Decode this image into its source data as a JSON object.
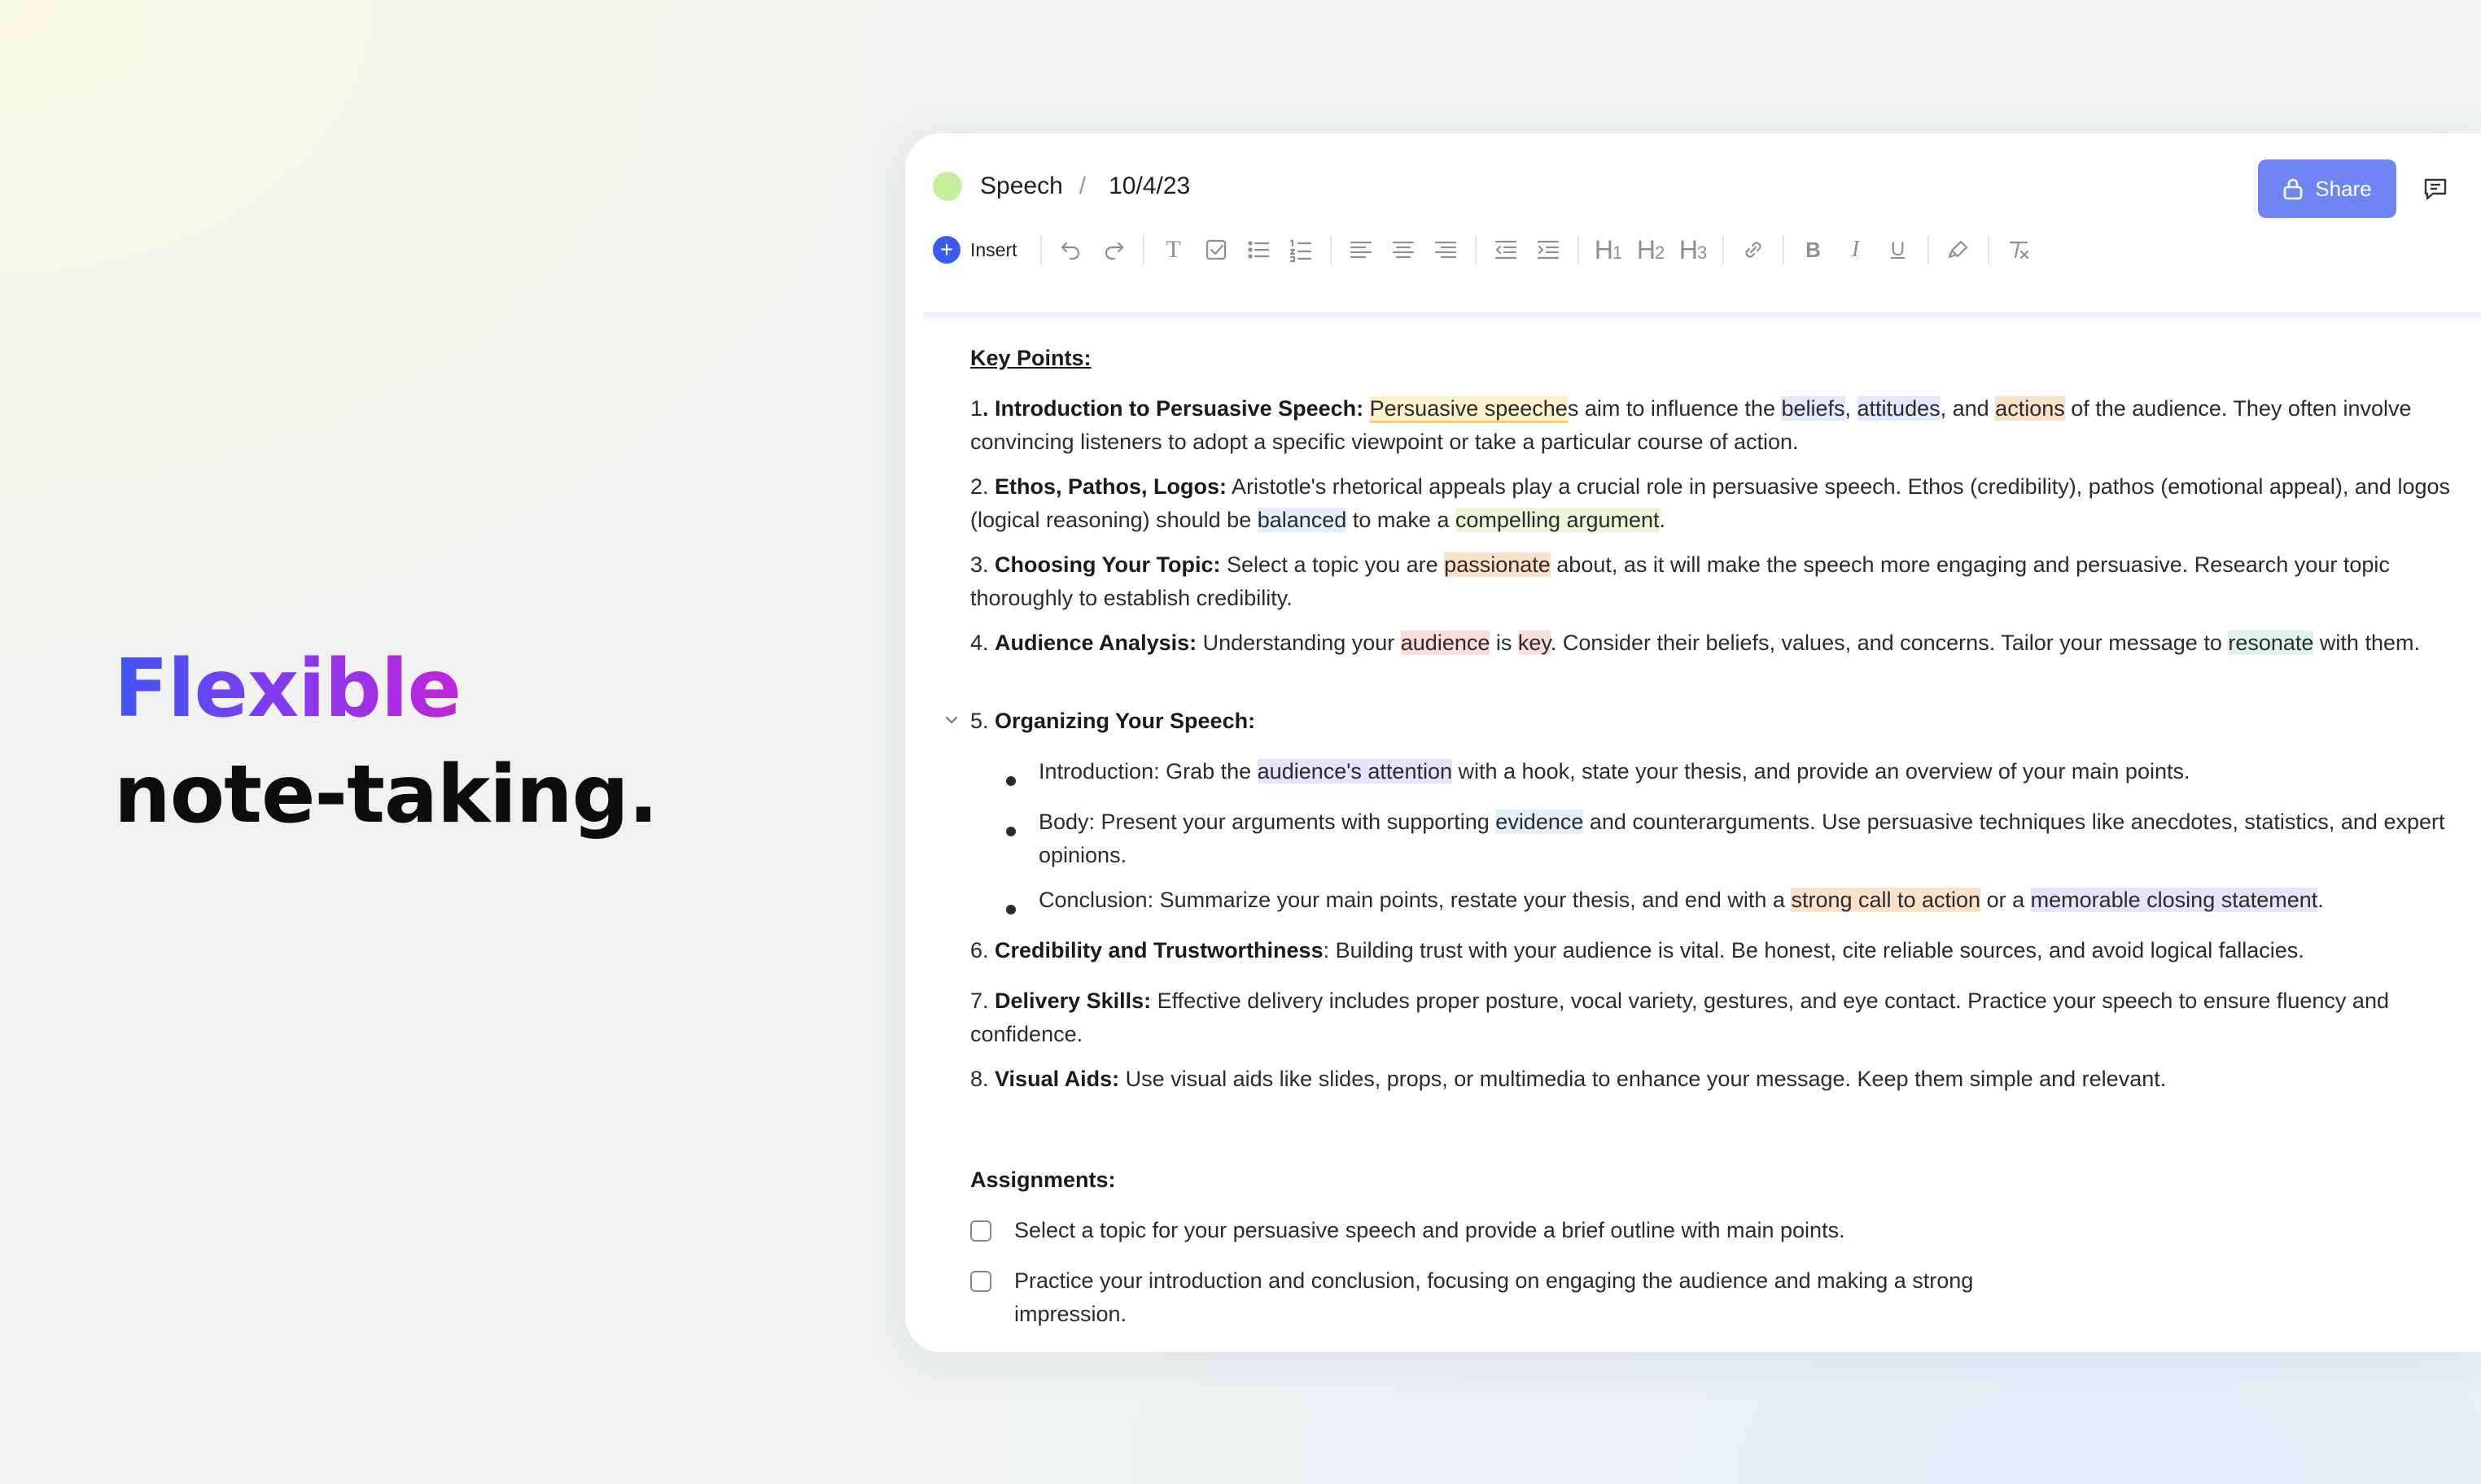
{
  "hero": {
    "line1": "Flexible",
    "line2": "note-taking."
  },
  "titlebar": {
    "title": "Speech",
    "separator": "/",
    "date": "10/4/23"
  },
  "share": {
    "label": "Share"
  },
  "toolbar": {
    "insert_label": "Insert"
  },
  "doc": {
    "key_points_heading": "Key Points:",
    "p1": {
      "num": "1",
      "bold": ". Introduction to Persuasive Speech:",
      "hl1": "Persuasive speeche",
      "t1": "s aim to influence the ",
      "hl2": "beliefs",
      "t2": ", ",
      "hl3": "attitudes",
      "t3": ", and ",
      "hl4": "actions",
      "t4": " of the audience. They often involve convincing listeners to adopt a specific viewpoint or take a particular course of action."
    },
    "p2": {
      "num": "2. ",
      "bold": "Ethos, Pathos, Logos:",
      "t1": " Aristotle's rhetorical appeals play a crucial role in persuasive speech. Ethos (credibility), pathos (emotional appeal), and logos (logical reasoning) should be ",
      "hl1": "balanced",
      "t2": " to make a ",
      "hl2": "compelling argument",
      "t3": "."
    },
    "p3": {
      "num": "3. ",
      "bold": "Choosing Your Topic:",
      "t1": " Select a topic you are ",
      "hl1": "passionate",
      "t2": " about, as it will make the speech more engaging and persuasive. Research your topic thoroughly to establish credibility."
    },
    "p4": {
      "num": "4. ",
      "bold": "Audience Analysis:",
      "t1": " Understanding your ",
      "hl1": "audience",
      "t2": " is ",
      "hl2": "key",
      "t3": ". Consider their beliefs, values, and concerns. Tailor your message to ",
      "hl3": "resonate",
      "t4": " with them."
    },
    "p5": {
      "num": "5. ",
      "bold": "Organizing Your Speech:"
    },
    "b1": {
      "t1": "Introduction: Grab the ",
      "hl1": "audience's attention",
      "t2": " with a hook, state your thesis, and provide an overview of your main points."
    },
    "b2": {
      "t1": "Body: Present your arguments with supporting ",
      "hl1": "evidence",
      "t2": " and counterarguments. Use persuasive techniques like anecdotes, statistics, and expert opinions."
    },
    "b3": {
      "t1": "Conclusion: Summarize your main points, restate your thesis, and end with a ",
      "hl1": "strong call to action",
      "t2": " or a ",
      "hl2": "memorable closing statement",
      "t3": "."
    },
    "p6": {
      "num": "6. ",
      "bold": "Credibility and Trustworthiness",
      "t1": ": Building trust with your audience is vital. Be honest, cite reliable sources, and avoid logical fallacies."
    },
    "p7": {
      "num": "7. ",
      "bold": "Delivery Skills:",
      "t1": " Effective delivery includes proper posture, vocal variety, gestures, and eye contact. Practice your speech to ensure fluency and confidence."
    },
    "p8": {
      "num": "8. ",
      "bold": "Visual Aids:",
      "t1": " Use visual aids like slides, props, or multimedia to enhance your message. Keep them simple and relevant."
    },
    "assignments_heading": "Assignments:",
    "tasks": [
      {
        "text": "Select a topic for your persuasive speech and provide a brief outline with main points.",
        "checked": false
      },
      {
        "text": "Practice your introduction and conclusion, focusing on engaging the audience and making a strong impression.",
        "checked": false
      }
    ]
  },
  "colors": {
    "accent": "#3a5bf0",
    "share_button": "#6e86f4",
    "hero_gradient": [
      "#3f56f2",
      "#7e3cf0",
      "#c024dc"
    ],
    "status_dot": "#c6ef9d"
  },
  "icons": [
    "plus-icon",
    "undo-icon",
    "redo-icon",
    "text-icon",
    "checklist-icon",
    "bullet-list-icon",
    "numbered-list-icon",
    "align-left-icon",
    "align-center-icon",
    "align-right-icon",
    "outdent-icon",
    "indent-icon",
    "heading1-icon",
    "heading2-icon",
    "heading3-icon",
    "link-icon",
    "bold-icon",
    "italic-icon",
    "underline-icon",
    "highlighter-icon",
    "clear-format-icon",
    "lock-icon",
    "comment-icon",
    "chevron-down-icon"
  ]
}
